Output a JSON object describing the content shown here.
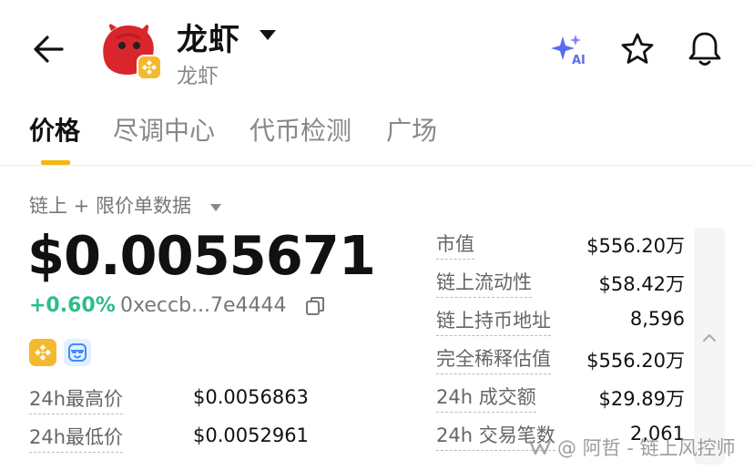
{
  "header": {
    "token_name": "龙虾",
    "token_subtitle": "龙虾",
    "icons": {
      "back": "arrow-left-icon",
      "ai": "ai-sparkle-icon",
      "favorite": "star-icon",
      "alerts": "bell-icon"
    },
    "ai_badge": "AI"
  },
  "tabs": [
    {
      "label": "价格",
      "active": true
    },
    {
      "label": "尽调中心",
      "active": false
    },
    {
      "label": "代币检测",
      "active": false
    },
    {
      "label": "广场",
      "active": false
    }
  ],
  "price_section": {
    "source_label": "链上 + 限价单数据",
    "price": "$0.0055671",
    "change": "+0.60%",
    "address": "0xeccb...7e4444",
    "stats": [
      {
        "label": "24h最高价",
        "value": "$0.0056863"
      },
      {
        "label": "24h最低价",
        "value": "$0.0052961"
      }
    ]
  },
  "market": [
    {
      "label": "市值",
      "value": "$556.20万"
    },
    {
      "label": "链上流动性",
      "value": "$58.42万"
    },
    {
      "label": "链上持币地址",
      "value": "8,596"
    },
    {
      "label": "完全稀释估值",
      "value": "$556.20万"
    },
    {
      "label": "24h 成交额",
      "value": "$29.89万"
    },
    {
      "label": "24h 交易笔数",
      "value": "2,061"
    }
  ],
  "watermark": "@ 阿哲 - 链上风控师",
  "colors": {
    "accent": "#F0B90B",
    "positive": "#2EBD85",
    "bnb": "#F3BA2F",
    "ai": "#5B6CF0"
  }
}
